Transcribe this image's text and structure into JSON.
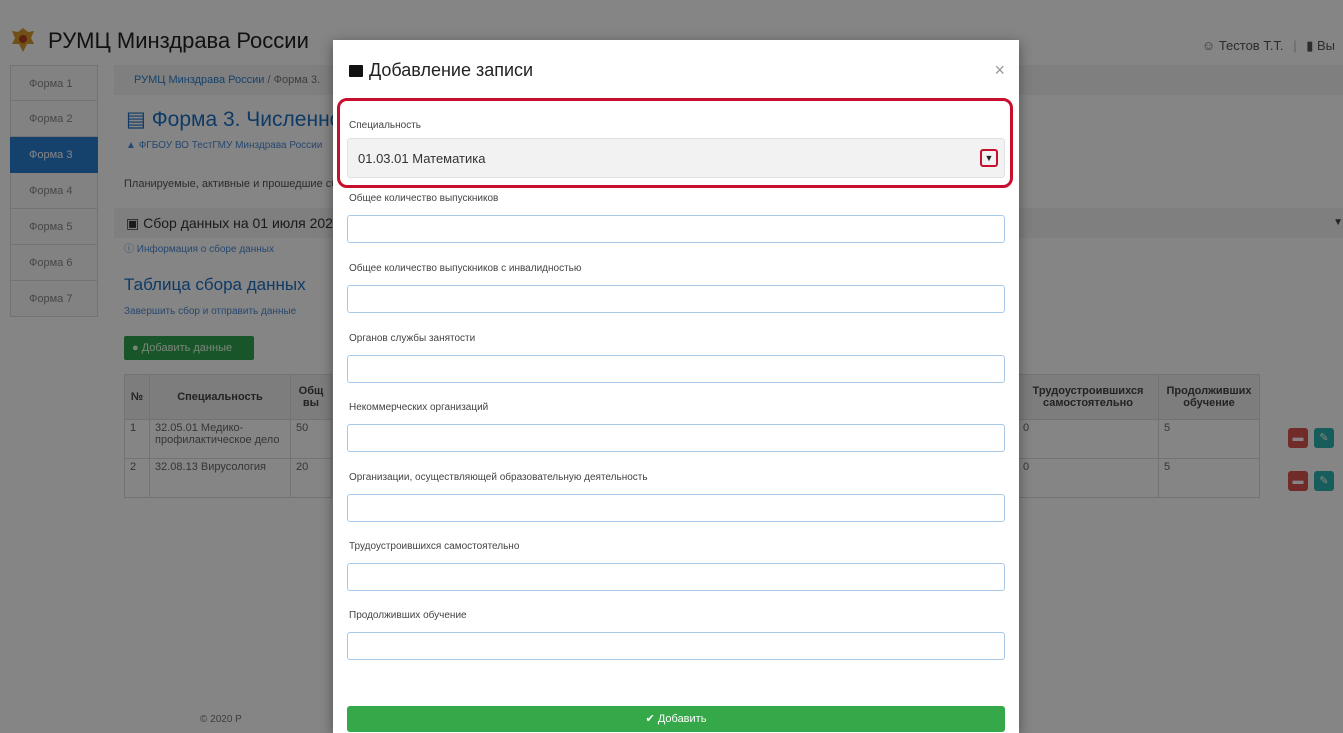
{
  "app": {
    "brand": "РУМЦ Минздрава России",
    "user": "Тестов Т.Т.",
    "logout": "Вы"
  },
  "sidebar": {
    "items": [
      {
        "label": "Форма 1",
        "active": false
      },
      {
        "label": "Форма 2",
        "active": false
      },
      {
        "label": "Форма 3",
        "active": true
      },
      {
        "label": "Форма 4",
        "active": false
      },
      {
        "label": "Форма 5",
        "active": false
      },
      {
        "label": "Форма 6",
        "active": false
      },
      {
        "label": "Форма 7",
        "active": false
      }
    ]
  },
  "page": {
    "breadcrumb_root": "РУМЦ Минздрава России",
    "breadcrumb_sep": " / ",
    "breadcrumb_current": "Форма 3.",
    "title": "Форма 3. Численно",
    "org": "ФГБОУ ВО ТестГМУ Минздрава России",
    "planned": "Планируемые, активные и прошедшие сб",
    "collect_title": "Сбор данных на 01 июля 202",
    "info_link": "Информация о сборе данных",
    "table_title": "Таблица сбора данных",
    "finish_link": "Завершить сбор и отправить данные",
    "add_data_btn": "Добавить данные",
    "footer": "© 2020 Р"
  },
  "table": {
    "headers": {
      "num": "№",
      "spec": "Специальность",
      "total": "Общ\nвы",
      "self": "Трудоустроившихся самостоятельно",
      "study": "Продолживших обучение"
    },
    "rows": [
      {
        "num": "1",
        "spec": "32.05.01 Медико-профилактическое дело",
        "total": "50",
        "self": "0",
        "study": "5"
      },
      {
        "num": "2",
        "spec": "32.08.13 Вирусология",
        "total": "20",
        "self": "0",
        "study": "5"
      }
    ]
  },
  "modal": {
    "title": "Добавление записи",
    "close": "×",
    "specialty_label": "Специальность",
    "specialty_value": "01.03.01 Математика",
    "fields": [
      {
        "label": "Общее количество выпускников",
        "value": ""
      },
      {
        "label": "Общее количество выпускников с инвалидностью",
        "value": ""
      },
      {
        "label": "Органов службы занятости",
        "value": ""
      },
      {
        "label": "Некоммерческих организаций",
        "value": ""
      },
      {
        "label": "Организации, осуществляющей образовательную деятельность",
        "value": ""
      },
      {
        "label": "Трудоустроившихся самостоятельно",
        "value": ""
      },
      {
        "label": "Продолживших обучение",
        "value": ""
      }
    ],
    "submit": "Добавить"
  },
  "icons": {
    "logo": "emblem-icon",
    "user": "users-icon",
    "logout": "logout-icon",
    "title": "form-icon",
    "collect": "database-icon",
    "info": "info-icon",
    "add": "plus-circle-icon",
    "delete": "trash-icon",
    "edit": "pencil-icon",
    "modal_title": "folder-icon",
    "submit": "check-icon"
  },
  "colors": {
    "accent": "#2a7fd1",
    "success": "#35a84a",
    "highlight": "#c8102e",
    "danger": "#d9534f"
  }
}
